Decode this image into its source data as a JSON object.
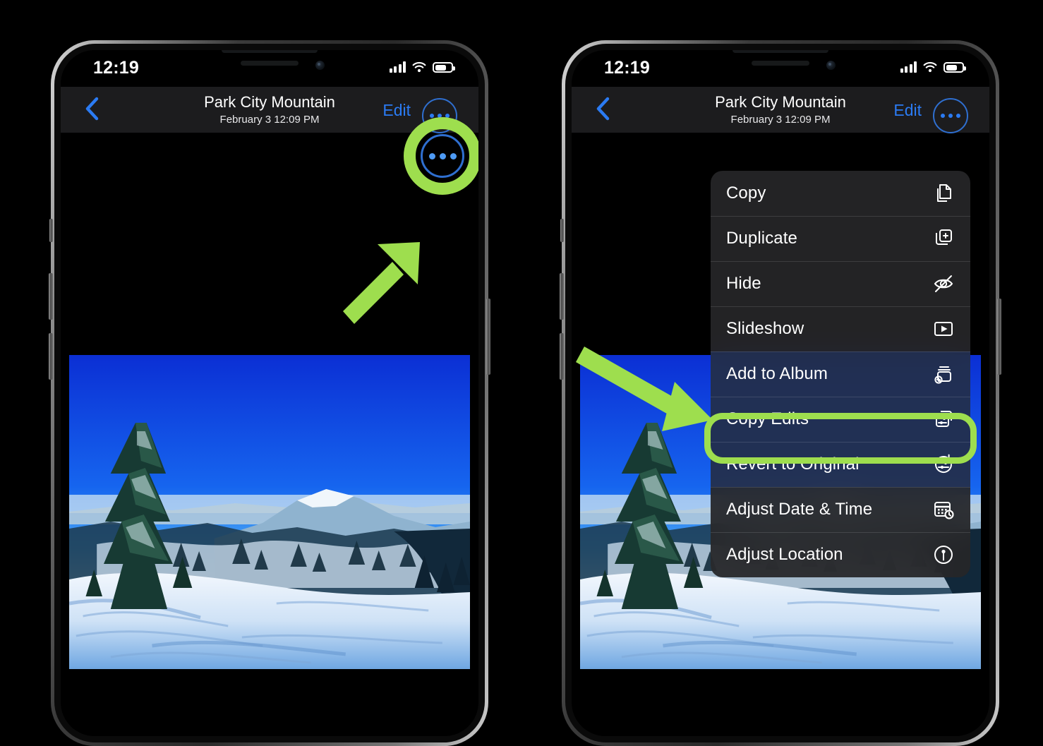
{
  "meta": {
    "background": "#000000",
    "highlight_color": "#9ede4e",
    "accent_blue": "#2b7bf3",
    "menu_bg": "#262628"
  },
  "phones": [
    {
      "id": "phone-left",
      "status_bar": {
        "time": "12:19",
        "signal_icon": "cellular-signal-icon",
        "wifi_icon": "wifi-icon",
        "battery_icon": "battery-icon",
        "battery_level": 62
      },
      "nav_bar": {
        "back_icon": "back-chevron-icon",
        "title": "Park City Mountain",
        "subtitle": "February 3  12:09 PM",
        "edit_label": "Edit",
        "more_icon": "more-ellipsis-icon"
      },
      "photo": {
        "alt": "Snowy mountain ski slope with evergreen trees and blue sky"
      },
      "annotations": {
        "ring_target": "more-ellipsis-icon",
        "arrow": "green-arrow-up-right"
      }
    },
    {
      "id": "phone-right",
      "status_bar": {
        "time": "12:19",
        "signal_icon": "cellular-signal-icon",
        "wifi_icon": "wifi-icon",
        "battery_icon": "battery-icon",
        "battery_level": 62
      },
      "nav_bar": {
        "back_icon": "back-chevron-icon",
        "title": "Park City Mountain",
        "subtitle": "February 3  12:09 PM",
        "edit_label": "Edit",
        "more_icon": "more-ellipsis-icon"
      },
      "photo": {
        "alt": "Snowy mountain ski slope with evergreen trees and blue sky"
      },
      "context_menu": {
        "items": [
          {
            "label": "Copy",
            "icon": "copy-icon"
          },
          {
            "label": "Duplicate",
            "icon": "duplicate-icon"
          },
          {
            "label": "Hide",
            "icon": "eye-slash-icon"
          },
          {
            "label": "Slideshow",
            "icon": "play-rectangle-icon"
          },
          {
            "label": "Add to Album",
            "icon": "add-to-album-icon"
          },
          {
            "label": "Copy Edits",
            "icon": "copy-edits-icon",
            "highlighted": true
          },
          {
            "label": "Revert to Original",
            "icon": "revert-icon"
          },
          {
            "label": "Adjust Date & Time",
            "icon": "calendar-clock-icon"
          },
          {
            "label": "Adjust Location",
            "icon": "location-pin-icon"
          }
        ]
      },
      "annotations": {
        "arrow": "green-arrow-down-right",
        "highlight_target": "Copy Edits"
      }
    }
  ]
}
